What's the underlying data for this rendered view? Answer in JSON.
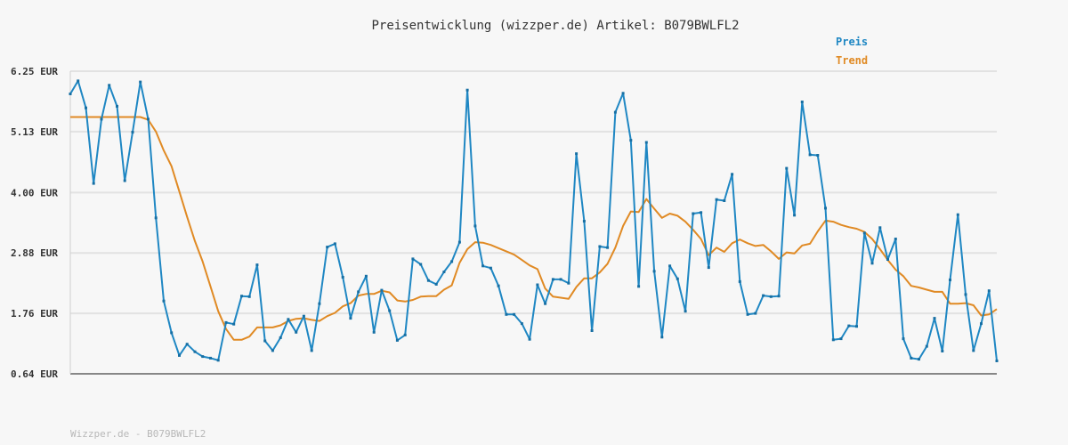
{
  "chart_data": {
    "type": "line",
    "title": "Preisentwicklung (wizzper.de) Artikel: B079BWLFL2",
    "footer": "Wizzper.de - B079BWLFL2",
    "y_ticks": [
      "6.25 EUR",
      "5.13 EUR",
      "4.00 EUR",
      "2.88 EUR",
      "1.76 EUR",
      "0.64 EUR"
    ],
    "y_tick_values": [
      6.25,
      5.13,
      4.0,
      2.88,
      1.76,
      0.64
    ],
    "ylim": [
      0.64,
      6.25
    ],
    "grid": true,
    "legend_placement": "top-right",
    "colors": {
      "preis": "#1f87c3",
      "trend": "#e08a24"
    },
    "series": [
      {
        "name": "Preis",
        "values": [
          5.83,
          6.07,
          5.57,
          4.17,
          5.36,
          5.99,
          5.6,
          4.22,
          5.12,
          6.05,
          5.36,
          3.53,
          1.99,
          1.4,
          0.98,
          1.19,
          1.05,
          0.96,
          0.93,
          0.89,
          1.59,
          1.56,
          2.08,
          2.07,
          2.66,
          1.25,
          1.07,
          1.31,
          1.65,
          1.41,
          1.71,
          1.07,
          1.94,
          2.99,
          3.05,
          2.43,
          1.67,
          2.16,
          2.45,
          1.41,
          2.19,
          1.81,
          1.26,
          1.36,
          2.77,
          2.67,
          2.37,
          2.3,
          2.53,
          2.72,
          3.08,
          5.9,
          3.38,
          2.64,
          2.6,
          2.27,
          1.74,
          1.74,
          1.57,
          1.28,
          2.29,
          1.94,
          2.39,
          2.39,
          2.32,
          4.72,
          3.47,
          1.44,
          3.0,
          2.98,
          5.49,
          5.84,
          4.97,
          2.26,
          4.93,
          2.54,
          1.32,
          2.64,
          2.4,
          1.8,
          3.61,
          3.63,
          2.61,
          3.87,
          3.85,
          4.34,
          2.35,
          1.74,
          1.76,
          2.09,
          2.07,
          2.08,
          4.45,
          3.58,
          5.68,
          4.7,
          4.69,
          3.71,
          1.27,
          1.29,
          1.53,
          1.52,
          3.25,
          2.69,
          3.35,
          2.76,
          3.14,
          1.29,
          0.93,
          0.91,
          1.15,
          1.67,
          1.06,
          2.38,
          3.59,
          2.11,
          1.07,
          1.57,
          2.18,
          0.88
        ]
      },
      {
        "name": "Trend",
        "values": [
          5.4,
          5.4,
          5.4,
          5.4,
          5.4,
          5.4,
          5.4,
          5.4,
          5.4,
          5.4,
          5.35,
          5.13,
          4.78,
          4.49,
          4.02,
          3.55,
          3.1,
          2.72,
          2.26,
          1.8,
          1.47,
          1.27,
          1.27,
          1.33,
          1.5,
          1.5,
          1.5,
          1.54,
          1.62,
          1.66,
          1.67,
          1.64,
          1.62,
          1.71,
          1.77,
          1.89,
          1.95,
          2.09,
          2.12,
          2.12,
          2.18,
          2.15,
          2.0,
          1.98,
          2.01,
          2.07,
          2.08,
          2.08,
          2.2,
          2.28,
          2.7,
          2.95,
          3.08,
          3.07,
          3.03,
          2.97,
          2.91,
          2.85,
          2.75,
          2.65,
          2.58,
          2.22,
          2.07,
          2.05,
          2.03,
          2.25,
          2.41,
          2.41,
          2.52,
          2.68,
          2.98,
          3.38,
          3.65,
          3.64,
          3.88,
          3.7,
          3.53,
          3.61,
          3.57,
          3.46,
          3.31,
          3.14,
          2.84,
          2.98,
          2.9,
          3.06,
          3.13,
          3.06,
          3.01,
          3.03,
          2.91,
          2.77,
          2.89,
          2.87,
          3.02,
          3.05,
          3.28,
          3.48,
          3.46,
          3.4,
          3.36,
          3.33,
          3.27,
          3.14,
          2.95,
          2.75,
          2.57,
          2.45,
          2.27,
          2.24,
          2.2,
          2.16,
          2.16,
          1.94,
          1.94,
          1.95,
          1.91,
          1.72,
          1.74,
          1.84
        ]
      }
    ]
  }
}
